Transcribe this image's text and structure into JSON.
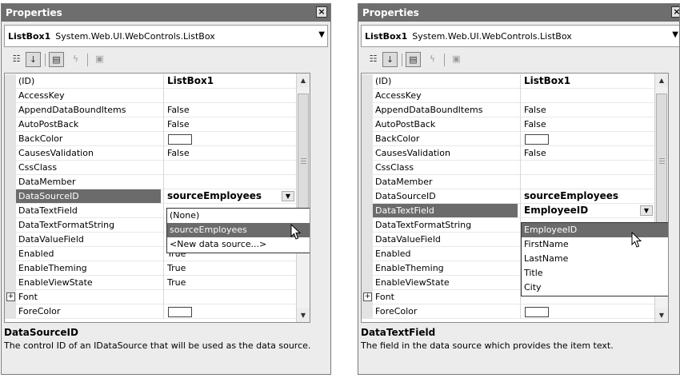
{
  "left_panel": {
    "title": "Properties",
    "close_label": "×",
    "object_name": "ListBox1",
    "object_type": "System.Web.UI.WebControls.ListBox",
    "properties": [
      {
        "name": "(ID)",
        "value": "ListBox1",
        "bold": true
      },
      {
        "name": "AccessKey",
        "value": ""
      },
      {
        "name": "AppendDataBoundItems",
        "value": "False"
      },
      {
        "name": "AutoPostBack",
        "value": "False"
      },
      {
        "name": "BackColor",
        "swatch": true
      },
      {
        "name": "CausesValidation",
        "value": "False"
      },
      {
        "name": "CssClass",
        "value": ""
      },
      {
        "name": "DataMember",
        "value": ""
      },
      {
        "name": "DataSourceID",
        "value": "sourceEmployees",
        "bold": true,
        "selected": true
      },
      {
        "name": "DataTextField",
        "value": ""
      },
      {
        "name": "DataTextFormatString",
        "value": ""
      },
      {
        "name": "DataValueField",
        "value": ""
      },
      {
        "name": "Enabled",
        "value": "True"
      },
      {
        "name": "EnableTheming",
        "value": "True"
      },
      {
        "name": "EnableViewState",
        "value": "True"
      },
      {
        "name": "Font",
        "value": "",
        "expander": true
      },
      {
        "name": "ForeColor",
        "swatch": true
      }
    ],
    "dropdown_options": [
      "(None)",
      "sourceEmployees",
      "<New data source...>"
    ],
    "dropdown_highlighted_index": 1,
    "description_title": "DataSourceID",
    "description_text": "The control ID of an IDataSource that will be used as the data source."
  },
  "right_panel": {
    "title": "Properties",
    "close_label": "×",
    "object_name": "ListBox1",
    "object_type": "System.Web.UI.WebControls.ListBox",
    "properties": [
      {
        "name": "(ID)",
        "value": "ListBox1",
        "bold": true
      },
      {
        "name": "AccessKey",
        "value": ""
      },
      {
        "name": "AppendDataBoundItems",
        "value": "False"
      },
      {
        "name": "AutoPostBack",
        "value": "False"
      },
      {
        "name": "BackColor",
        "swatch": true
      },
      {
        "name": "CausesValidation",
        "value": "False"
      },
      {
        "name": "CssClass",
        "value": ""
      },
      {
        "name": "DataMember",
        "value": ""
      },
      {
        "name": "DataSourceID",
        "value": "sourceEmployees",
        "bold": true
      },
      {
        "name": "DataTextField",
        "value": "EmployeeID",
        "bold": true,
        "selected": true
      },
      {
        "name": "DataTextFormatString",
        "value": ""
      },
      {
        "name": "DataValueField",
        "value": ""
      },
      {
        "name": "Enabled",
        "value": ""
      },
      {
        "name": "EnableTheming",
        "value": ""
      },
      {
        "name": "EnableViewState",
        "value": ""
      },
      {
        "name": "Font",
        "value": "",
        "expander": true
      },
      {
        "name": "ForeColor",
        "swatch": true
      }
    ],
    "dropdown_options": [
      "EmployeeID",
      "FirstName",
      "LastName",
      "Title",
      "City"
    ],
    "dropdown_highlighted_index": 0,
    "description_title": "DataTextField",
    "description_text": "The field in the data source which provides the item text."
  },
  "toolbar_icons": [
    "categorized-icon",
    "alphabetical-icon",
    "properties-icon",
    "events-icon",
    "property-pages-icon"
  ],
  "colors": {
    "title_bar": "#6e6e6e",
    "selection": "#6b6b6b",
    "panel_bg": "#ececec"
  }
}
